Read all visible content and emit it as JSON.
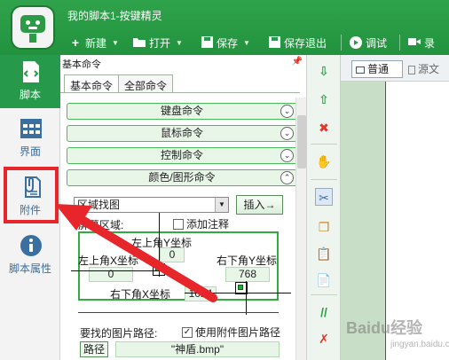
{
  "window": {
    "title": "我的脚本1-按键精灵"
  },
  "toolbar": {
    "new": "新建",
    "open": "打开",
    "save": "保存",
    "save_exit": "保存退出",
    "debug": "调试",
    "record": "录"
  },
  "sidebar": {
    "items": [
      {
        "label": "脚本",
        "icon": "script-icon"
      },
      {
        "label": "界面",
        "icon": "grid-icon"
      },
      {
        "label": "附件",
        "icon": "attachment-icon"
      },
      {
        "label": "脚本属性",
        "icon": "info-icon"
      }
    ]
  },
  "panel": {
    "header": "基本命令",
    "tabs": [
      "基本命令",
      "全部命令"
    ],
    "categories": [
      "键盘命令",
      "鼠标命令",
      "控制命令",
      "颜色/图形命令"
    ]
  },
  "form": {
    "command_select": "区域找图",
    "insert_button": "插入→",
    "screen_area_label": "屏幕区域:",
    "add_annotation": "添加注释",
    "top_left_y_label": "左上角Y坐标",
    "top_left_y_value": "0",
    "top_left_x_label": "左上角X坐标",
    "top_left_x_value": "0",
    "bottom_right_y_label": "右下角Y坐标",
    "bottom_right_y_value": "768",
    "bottom_right_x_label": "右下角X坐标",
    "bottom_right_x_value": "1024",
    "image_path_label": "要找的图片路径:",
    "use_attach_path": "使用附件图片路径",
    "path_button": "路径",
    "path_value": "\"神盾.bmp\""
  },
  "editor": {
    "tab_normal": "普通",
    "tab_source": "源文"
  },
  "watermark": {
    "main": "Baidu经验",
    "sub": "jingyan.baidu.com"
  },
  "colors": {
    "accent_green": "#26994a",
    "highlight_red": "#e6262b"
  }
}
